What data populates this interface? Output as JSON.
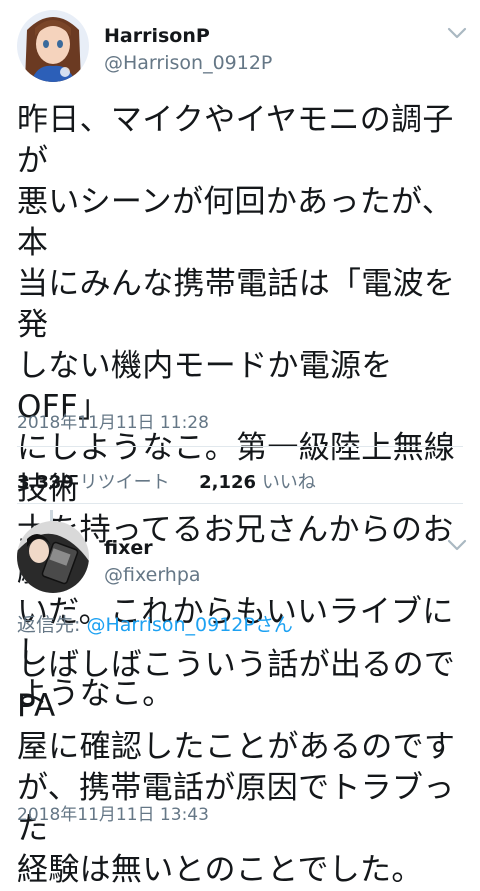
{
  "tweet1": {
    "display_name": "HarrisonP",
    "handle": "@Harrison_0912P",
    "text": "昨日、マイクやイヤモニの調子が\n悪いシーンが何回かあったが、本\n当にみんな携帯電話は「電波を発\nしない機内モードか電源をOFF」\nにしようなこ。第一級陸上無線技術\n士を持ってるお兄さんからのお願\nいだ。これからもいいライブにし\nようなこ。",
    "timestamp": "2018年11月11日 11:28",
    "retweet_count": "3,339",
    "retweet_label": "リツイート",
    "like_count": "2,126",
    "like_label": "いいね"
  },
  "tweet2": {
    "display_name": "fixer",
    "handle": "@fixerhpa",
    "reply_prefix": "返信先: ",
    "reply_target": "@Harrison_0912Pさん",
    "text": "しばしばこういう話が出るのでPA\n屋に確認したことがあるのです\nが、携帯電話が原因でトラブった\n経験は無いとのことでした。",
    "timestamp": "2018年11月11日 13:43"
  },
  "icons": {
    "menu": "chevron-down-icon"
  }
}
